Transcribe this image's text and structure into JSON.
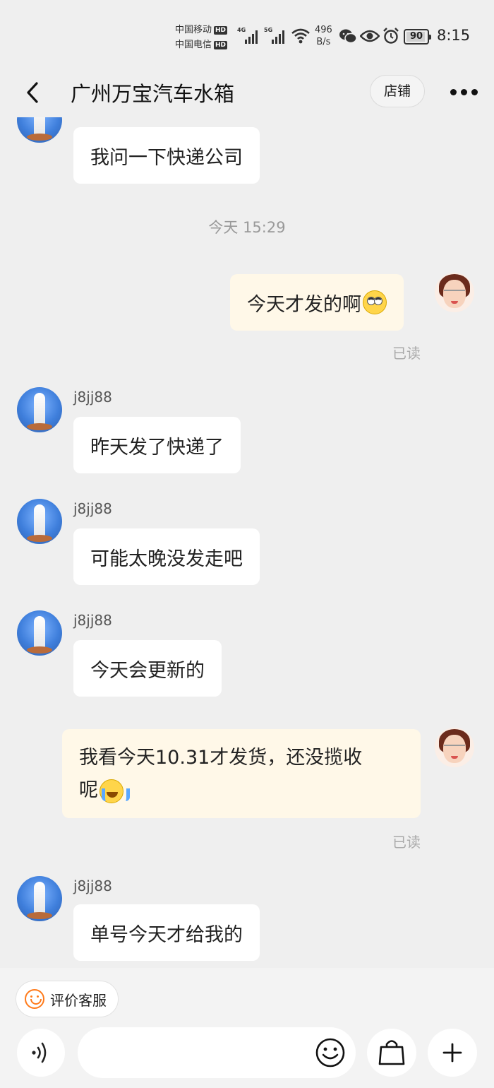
{
  "status_bar": {
    "carrier1": "中国移动",
    "carrier2": "中国电信",
    "hd_badge": "HD",
    "net1": "4G",
    "net2": "5G",
    "speed_value": "496",
    "speed_unit": "B/s",
    "battery": "90",
    "time": "8:15"
  },
  "header": {
    "title": "广州万宝汽车水箱",
    "shop_label": "店铺"
  },
  "chat": {
    "top_message": "我问一下快递公司",
    "timestamp": "今天  15:29",
    "messages": [
      {
        "text": "今天才发的啊"
      },
      {
        "read": "已读"
      },
      {
        "nick": "j8jj88",
        "text": "昨天发了快递了"
      },
      {
        "nick": "j8jj88",
        "text": "可能太晚没发走吧"
      },
      {
        "nick": "j8jj88",
        "text": "今天会更新的"
      },
      {
        "text_line1": "我看今天10.31才发货，还没揽收",
        "text_line2": "呢"
      },
      {
        "read": "已读"
      },
      {
        "nick": "j8jj88",
        "text": "单号今天才给我的"
      }
    ]
  },
  "bottom": {
    "rate_label": "评价客服",
    "input_placeholder": ""
  }
}
